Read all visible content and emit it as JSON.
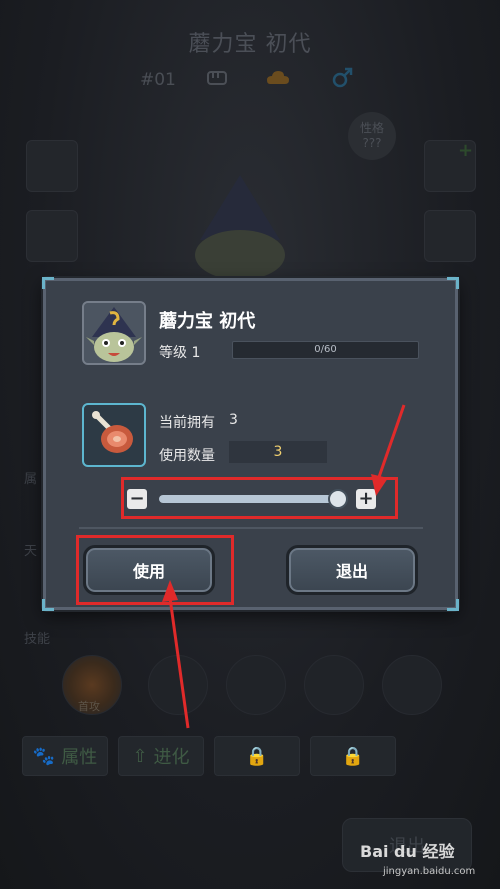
{
  "background": {
    "title": "蘑力宝 初代",
    "number": "#01",
    "badge_line1": "性格",
    "badge_line2": "???",
    "labels": [
      "属",
      "天",
      "技能"
    ],
    "skill_caption": "首攻",
    "tabs": [
      "属性",
      "进化"
    ],
    "exit_label": "退出"
  },
  "dialog": {
    "monster_name": "蘑力宝 初代",
    "level_label": "等级 1",
    "exp_text": "0/60",
    "exp_fraction": 0.0,
    "owned_label": "当前拥有",
    "owned_value": "3",
    "qty_label": "使用数量",
    "qty_value": "3",
    "slider_fraction": 1.0,
    "minus_label": "−",
    "plus_label": "+",
    "use_button": "使用",
    "exit_button": "退出"
  },
  "watermark": {
    "brand": "Bai du 经验",
    "url": "jingyan.baidu.com"
  },
  "colors": {
    "highlight": "#e02a2a",
    "dialog_bg": "#3a414b",
    "accent_frame": "#6bb3c9",
    "qty_text": "#f0d070"
  },
  "icons": [
    "fist-icon",
    "cloud-icon",
    "male-gender-icon",
    "lock-icon",
    "meat-item-icon",
    "monster-avatar-icon"
  ]
}
